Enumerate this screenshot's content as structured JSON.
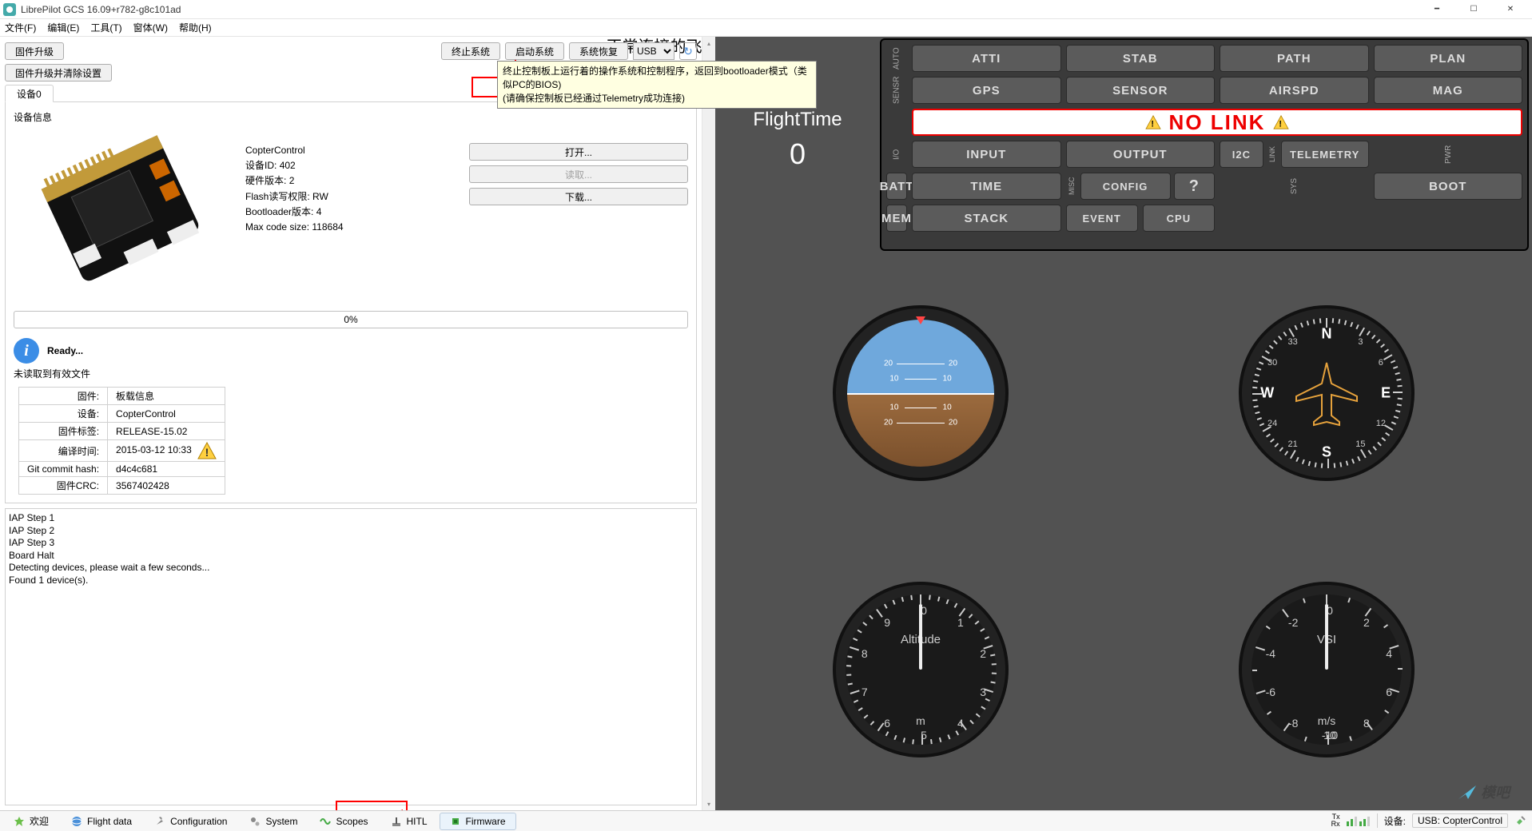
{
  "window": {
    "title": "LibrePilot GCS 16.09+r782-g8c101ad"
  },
  "menubar": {
    "file": "文件(F)",
    "edit": "编辑(E)",
    "tools": "工具(T)",
    "window": "窗体(W)",
    "help": "帮助(H)"
  },
  "annotation_top": "正常连接的飞控可以通过该按键进入固件刷写",
  "toolbar": {
    "firmware_upgrade": "固件升级",
    "firmware_upgrade_clear": "固件升级并清除设置",
    "halt": "终止系统",
    "boot": "启动系统",
    "recover": "系统恢复",
    "port": "USB",
    "reset": "重启信息"
  },
  "tooltip": {
    "line1": "终止控制板上运行着的操作系统和控制程序，返回到bootloader模式（类似PC的BIOS)",
    "line2": "(请确保控制板已经通过Telemetry成功连接)"
  },
  "tab": {
    "device0": "设备0"
  },
  "device": {
    "section_label": "设备信息",
    "name": "CopterControl",
    "id_label": "设备ID:",
    "id_val": "402",
    "hw_label": "硬件版本:",
    "hw_val": "2",
    "flash_label": "Flash读写权限:",
    "flash_val": "RW",
    "bl_label": "Bootloader版本:",
    "bl_val": "4",
    "maxcode_label": "Max code size:",
    "maxcode_val": "118684",
    "open": "打开...",
    "read": "读取...",
    "download": "下载...",
    "progress": "0%"
  },
  "status": {
    "ready": "Ready...",
    "no_valid": "未读取到有效文件"
  },
  "info_table": {
    "h_fw": "固件:",
    "h_board": "板载信息",
    "r_dev": "设备:",
    "v_dev": "CopterControl",
    "r_tag": "固件标签:",
    "v_tag": "RELEASE-15.02",
    "r_build": "编译时间:",
    "v_build": "2015-03-12 10:33",
    "r_git": "Git commit hash:",
    "v_git": "d4c4c681",
    "r_crc": "固件CRC:",
    "v_crc": "3567402428"
  },
  "log": {
    "l1": "IAP Step 1",
    "l2": "IAP Step 2",
    "l3": "IAP Step 3",
    "l4": "Board Halt",
    "l5": "Detecting devices, please wait a few seconds...",
    "l6": "Found 1 device(s)."
  },
  "flighttime": {
    "label": "FlightTime",
    "value": "0"
  },
  "status_grid": {
    "row_auto": "AUTO",
    "row_sensr": "SENSR",
    "row_io": "I/O",
    "row_pwr": "PWR",
    "row_sys": "SYS",
    "atti": "ATTI",
    "stab": "STAB",
    "path": "PATH",
    "plan": "PLAN",
    "gps": "GPS",
    "sensor": "SENSOR",
    "airspd": "AIRSPD",
    "mag": "MAG",
    "nolink": "NO LINK",
    "input": "INPUT",
    "output": "OUTPUT",
    "i2c": "I2C",
    "tele": "TELEMETRY",
    "link_v": "LINK",
    "batt": "BATT",
    "time": "TIME",
    "misc_v": "MISC",
    "config": "CONFIG",
    "q": "?",
    "boot": "BOOT",
    "mem": "MEM",
    "stack": "STACK",
    "event": "EVENT",
    "cpu": "CPU"
  },
  "gauges": {
    "alt_label": "Altitude",
    "alt_unit": "m",
    "vsi_label": "VSI",
    "vsi_unit": "m/s",
    "compass": {
      "n": "N",
      "e": "E",
      "s": "S",
      "w": "W",
      "n3": "3",
      "n6": "6",
      "n12": "12",
      "n15": "15",
      "n21": "21",
      "n24": "24",
      "n30": "30",
      "n33": "33"
    },
    "alt_nums": {
      "n0": "0",
      "n1": "1",
      "n2": "2",
      "n3": "3",
      "n4": "4",
      "n5": "5",
      "n6": "6",
      "n7": "7",
      "n8": "8",
      "n9": "9"
    },
    "vsi_nums": {
      "p0": "0",
      "p2": "2",
      "p4": "4",
      "p6": "6",
      "p8": "8",
      "p10": "10",
      "m2": "-2",
      "m4": "-4",
      "m6": "-6",
      "m8": "-8",
      "m10": "-10"
    },
    "atti_nums": {
      "p10": "10",
      "p20": "20",
      "m10": "10",
      "m20": "20"
    }
  },
  "bottom_tabs": {
    "welcome": "欢迎",
    "flightdata": "Flight data",
    "config": "Configuration",
    "system": "System",
    "scopes": "Scopes",
    "hitl": "HITL",
    "firmware": "Firmware"
  },
  "statusbar": {
    "device": "设备:",
    "conn": "USB: CopterControl",
    "tx": "Tx",
    "rx": "Rx"
  },
  "watermark": "模吧"
}
